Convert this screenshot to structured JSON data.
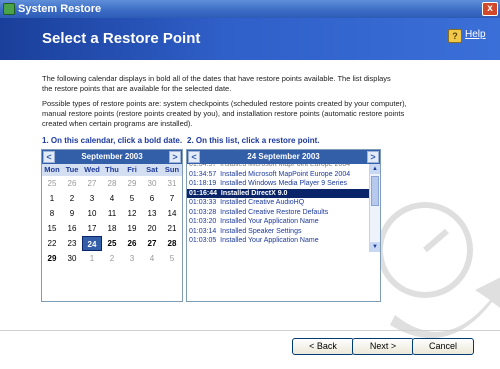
{
  "window": {
    "title": "System Restore",
    "close_label": "x"
  },
  "banner": {
    "heading": "Select a Restore Point",
    "help_label": "Help"
  },
  "intro": {
    "paragraph1": "The following calendar displays in bold all of the dates that have restore points available. The list displays the restore points that are available for the selected date.",
    "paragraph2": "Possible types of restore points are: system checkpoints (scheduled restore points created by your computer), manual restore points (restore points created by you), and installation restore points (automatic restore points created when certain programs are installed)."
  },
  "steps": {
    "step1": "1. On this calendar, click a bold date.",
    "step2": "2. On this list, click a restore point."
  },
  "calendar": {
    "month_label": "September 2003",
    "prev": "<",
    "next": ">",
    "weekdays": [
      "Mon",
      "Tue",
      "Wed",
      "Thu",
      "Fri",
      "Sat",
      "Sun"
    ],
    "weeks": [
      [
        "1",
        "2",
        "3",
        "4",
        "5",
        "6",
        "7"
      ],
      [
        "25",
        "26",
        "27",
        "28",
        "29",
        "30",
        "31"
      ],
      [
        "1",
        "2",
        "3",
        "4",
        "5",
        "6",
        "7"
      ],
      [
        "8",
        "9",
        "10",
        "11",
        "12",
        "13",
        "14"
      ],
      [
        "15",
        "16",
        "17",
        "18",
        "19",
        "20",
        "21"
      ],
      [
        "22",
        "23",
        "24",
        "25",
        "26",
        "27",
        "28"
      ],
      [
        "29",
        "30",
        "1",
        "2",
        "3",
        "4",
        "5"
      ]
    ]
  },
  "restore_list": {
    "date_label": "24 September 2003",
    "items": [
      {
        "time": "01:34:57",
        "desc": "Installed Microsoft MapPoint Europe 2004"
      },
      {
        "time": "01:18:19",
        "desc": "Installed Windows Media Player 9 Series"
      },
      {
        "time": "01:16:44",
        "desc": "Installed DirectX 9.0"
      },
      {
        "time": "01:03:33",
        "desc": "Installed Creative AudioHQ"
      },
      {
        "time": "01:03:28",
        "desc": "Installed Creative Restore Defaults"
      },
      {
        "time": "01:03:20",
        "desc": "Installed Your Application Name"
      },
      {
        "time": "01:03:14",
        "desc": "Installed Speaker Settings"
      },
      {
        "time": "01:03:05",
        "desc": "Installed Your Application Name"
      }
    ]
  },
  "buttons": {
    "back": "< Back",
    "next": "Next >",
    "cancel": "Cancel"
  }
}
